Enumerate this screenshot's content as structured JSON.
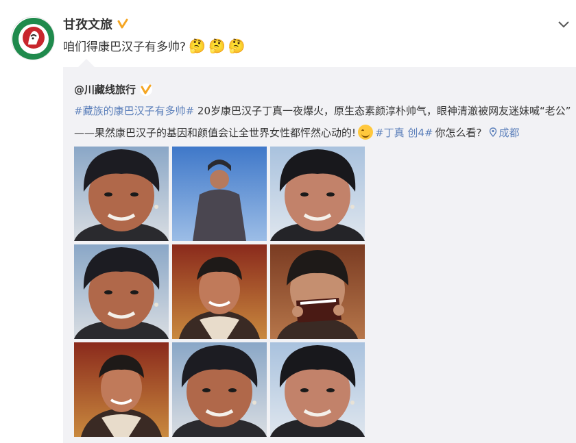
{
  "colors": {
    "link": "#5b7fba",
    "verified": "#f5a623",
    "repost_bg": "#f2f2f5",
    "logo_green": "#1f8a4c",
    "logo_red": "#c8262d"
  },
  "post": {
    "author": {
      "name": "甘孜文旅",
      "badge": "verified-badge"
    },
    "avatar": {
      "logo_text_top": "HOLY GARZE",
      "logo_text_bottom": "幸福甘孜"
    },
    "text": "咱们得康巴汉子有多帅?",
    "emojis": [
      "🤔",
      "🤔",
      "🤔"
    ]
  },
  "repost": {
    "author": "@川藏线旅行",
    "line1": {
      "hashtag": "#藏族的康巴汉子有多帅#",
      "text": " 20岁康巴汉子丁真一夜爆火，原生态素颜淳朴帅气，眼神清澈被网友迷妹喊“老公”"
    },
    "line2": {
      "text": "——果然康巴汉子的基因和颜值会让全世界女性都怦然心动的!",
      "emoji_icon": "smile-emoji-icon",
      "hashtag": "#丁真 创4#",
      "question": " 你怎么看?",
      "location_icon": "location-pin-icon",
      "location": "成都"
    },
    "photos": [
      {
        "name": "photo-1",
        "scene": "closeup-mountain"
      },
      {
        "name": "photo-2",
        "scene": "standing-sky"
      },
      {
        "name": "photo-3",
        "scene": "smile-sky"
      },
      {
        "name": "photo-4",
        "scene": "closeup-mountain"
      },
      {
        "name": "photo-5",
        "scene": "indoor-red"
      },
      {
        "name": "photo-6",
        "scene": "mask-indoor"
      },
      {
        "name": "photo-7",
        "scene": "indoor-red"
      },
      {
        "name": "photo-8",
        "scene": "closeup-mountain"
      },
      {
        "name": "photo-9",
        "scene": "smile-sky"
      }
    ]
  }
}
